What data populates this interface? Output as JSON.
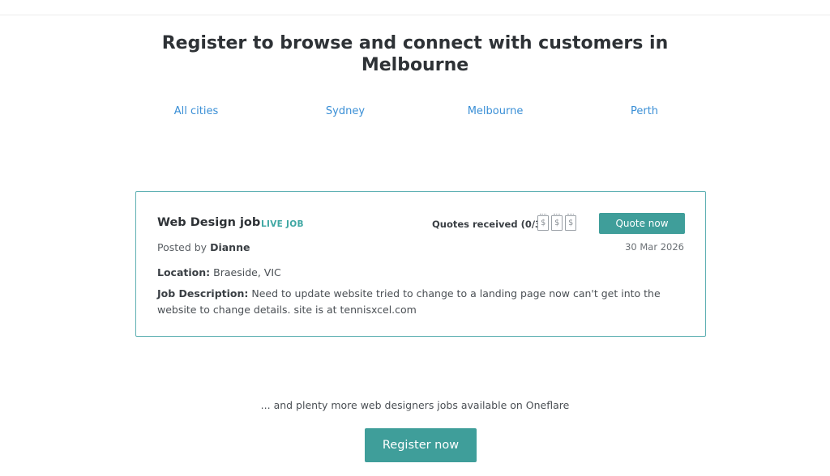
{
  "headline": {
    "line1": "Register to browse and connect with customers in",
    "line2": "Melbourne"
  },
  "cities": [
    {
      "label": "All cities"
    },
    {
      "label": "Sydney"
    },
    {
      "label": "Melbourne"
    },
    {
      "label": "Perth"
    }
  ],
  "job": {
    "title": "Web Design job",
    "badge": "LIVE JOB",
    "quotes_label": "Quotes received (0/3)",
    "quote_icon": "dollar-receipt",
    "quote_symbol": "$",
    "quote_button": "Quote now",
    "posted_prefix": "Posted by",
    "posted_by": "Dianne",
    "date": "30 Mar 2026",
    "location_label": "Location:",
    "location": "Braeside, VIC",
    "description_label": "Job Description:",
    "description": "Need to update website tried to change to a landing page now can't get into the website to change details. site is at tennisxcel.com"
  },
  "footer": {
    "more_text": "... and plenty more web designers jobs available on Oneflare",
    "register_button": "Register now"
  },
  "colors": {
    "accent_teal": "#3f9e9a",
    "link_blue": "#3a8fd6",
    "card_border": "#5fb0b3"
  }
}
